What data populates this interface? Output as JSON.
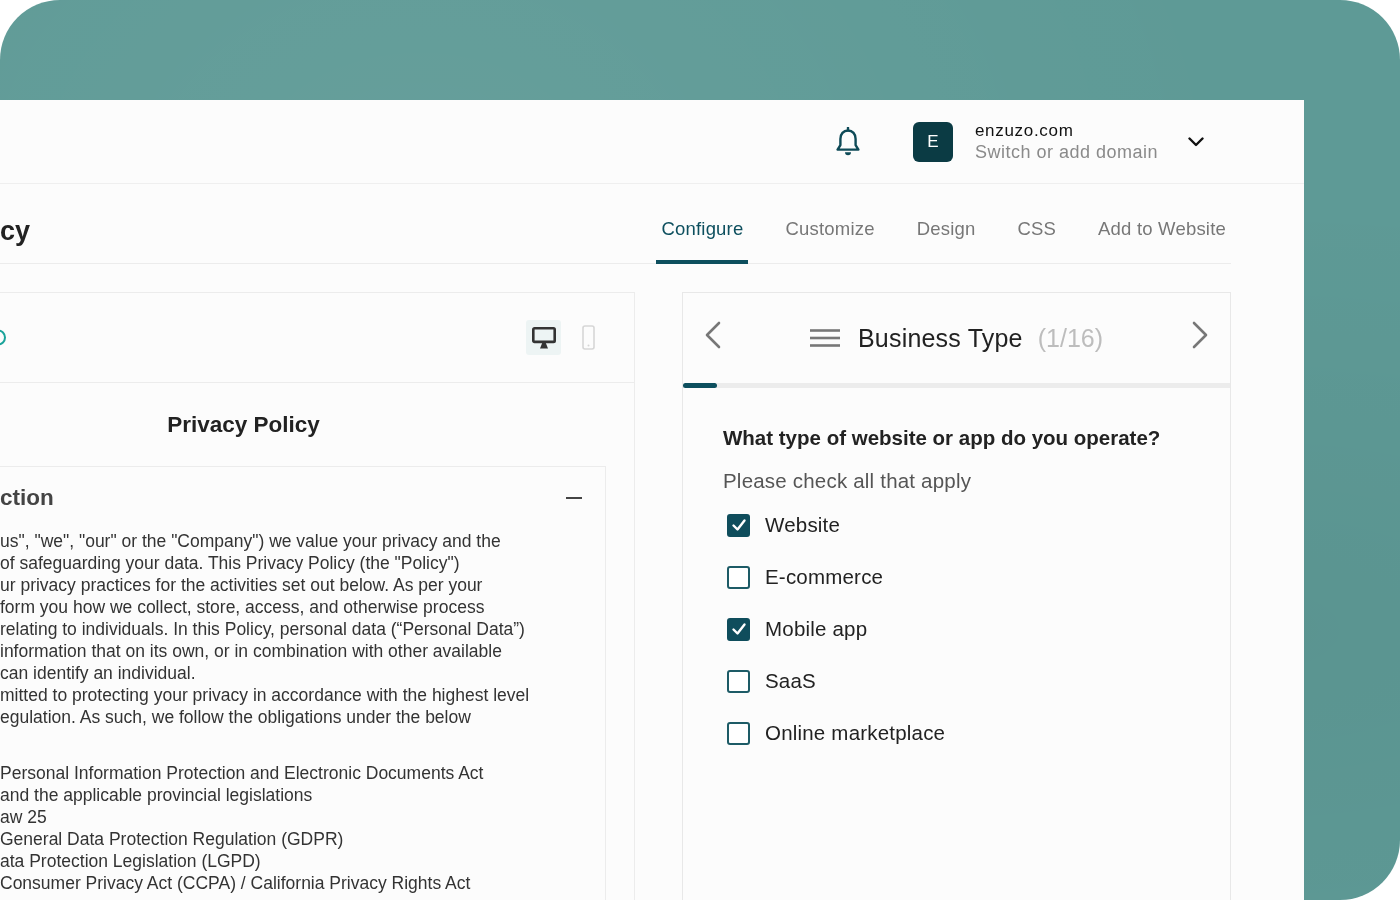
{
  "account": {
    "avatar_letter": "E",
    "domain": "enzuzo.com",
    "subtitle": "Switch or add domain"
  },
  "page": {
    "title": "cy",
    "tabs": [
      {
        "label": "Configure",
        "selected": true
      },
      {
        "label": "Customize",
        "selected": false
      },
      {
        "label": "Design",
        "selected": false
      },
      {
        "label": "CSS",
        "selected": false
      },
      {
        "label": "Add to Website",
        "selected": false
      }
    ]
  },
  "preview": {
    "view_modes": [
      {
        "kind": "desktop",
        "selected": true
      },
      {
        "kind": "mobile",
        "selected": false
      }
    ],
    "document_title": "Privacy Policy",
    "section": {
      "title": "ction",
      "expanded": true,
      "paragraphs": [
        {
          "lines": [
            "us\", \"we\", \"our\" or the \"Company\") we value your privacy and the",
            "of safeguarding your data. This Privacy Policy (the \"Policy\")",
            "ur privacy practices for the activities set out below. As per your",
            "form you how we collect, store, access, and otherwise process",
            "relating to individuals. In this Policy, personal data (“Personal Data”)",
            "information that on its own, or in combination with other available",
            "can identify an individual.",
            "mitted to protecting your privacy in accordance with the highest level",
            "egulation. As such, we follow the obligations under the below"
          ]
        },
        {
          "lines": [
            "Personal Information Protection and Electronic Documents Act",
            "and the applicable provincial legislations",
            "aw 25",
            "General Data Protection Regulation (GDPR)",
            "ata Protection Legislation (LGPD)",
            "Consumer Privacy Act (CCPA) / California Privacy Rights Act"
          ]
        }
      ]
    }
  },
  "questionnaire": {
    "step_title": "Business Type",
    "step_count": "(1/16)",
    "progress": {
      "level": 0.0625
    },
    "question": "What type of website or app do you operate?",
    "hint": "Please check all that apply",
    "options": [
      {
        "label": "Website",
        "checked": true
      },
      {
        "label": "E-commerce",
        "checked": false
      },
      {
        "label": "Mobile app",
        "checked": true
      },
      {
        "label": "SaaS",
        "checked": false
      },
      {
        "label": "Online marketplace",
        "checked": false
      }
    ]
  }
}
